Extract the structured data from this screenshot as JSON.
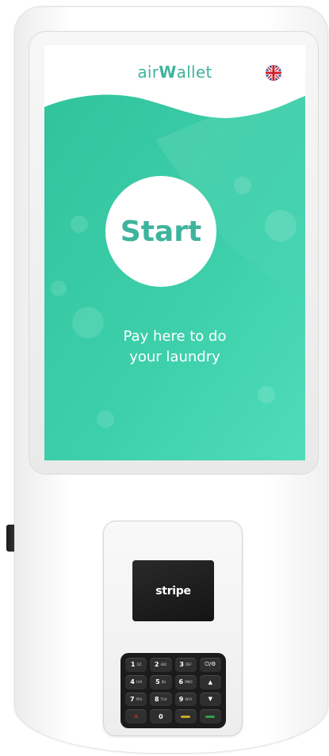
{
  "screen": {
    "logo_prefix": "air",
    "logo_bold": "W",
    "logo_suffix": "allet",
    "language_flag_icon": "uk-flag-icon",
    "start_label": "Start",
    "subtitle_line1": "Pay here to do",
    "subtitle_line2": "your laundry"
  },
  "terminal": {
    "brand": "stripe",
    "keys": [
      {
        "num": "1",
        "sub": "QZ"
      },
      {
        "num": "2",
        "sub": "ABC"
      },
      {
        "num": "3",
        "sub": "DEF"
      },
      {
        "glyph": "⏻/⚙"
      },
      {
        "num": "4",
        "sub": "GHI"
      },
      {
        "num": "5",
        "sub": "JKL"
      },
      {
        "num": "6",
        "sub": "MNO"
      },
      {
        "glyph": "▲"
      },
      {
        "num": "7",
        "sub": "PRS"
      },
      {
        "num": "8",
        "sub": "TUV"
      },
      {
        "num": "9",
        "sub": "WXY"
      },
      {
        "glyph": "▼"
      },
      {
        "glyph": "✕"
      },
      {
        "num": "0",
        "sub": ""
      },
      {
        "glyph": ""
      },
      {
        "glyph": ""
      }
    ]
  },
  "colors": {
    "teal": "#3fb49c",
    "teal_light": "#5ed6bd",
    "white": "#ffffff",
    "cancel_red": "#e0342c",
    "clear_yellow": "#c9a91d",
    "confirm_green": "#2fa14a"
  }
}
